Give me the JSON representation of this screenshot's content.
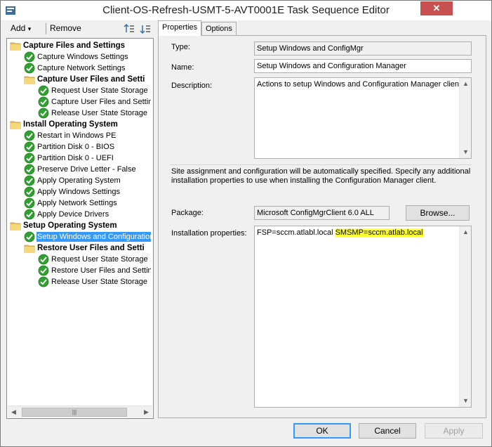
{
  "window": {
    "title": "Client-OS-Refresh-USMT-5-AVT0001E Task Sequence Editor",
    "close_glyph": "✕"
  },
  "toolbar": {
    "add_label": "Add",
    "add_arrow": "▾",
    "remove_label": "Remove"
  },
  "tree": {
    "items": [
      {
        "label": "Capture Files and Settings",
        "type": "group",
        "level": 0
      },
      {
        "label": "Capture Windows Settings",
        "type": "step",
        "level": 1
      },
      {
        "label": "Capture Network Settings",
        "type": "step",
        "level": 1
      },
      {
        "label": "Capture User Files and Setti",
        "type": "group",
        "level": 1
      },
      {
        "label": "Request User State Storage",
        "type": "step",
        "level": 2
      },
      {
        "label": "Capture User Files and Setting",
        "type": "step",
        "level": 2
      },
      {
        "label": "Release User State Storage",
        "type": "step",
        "level": 2
      },
      {
        "label": "Install Operating System",
        "type": "group",
        "level": 0
      },
      {
        "label": "Restart in Windows PE",
        "type": "step",
        "level": 1
      },
      {
        "label": "Partition Disk 0 - BIOS",
        "type": "step",
        "level": 1
      },
      {
        "label": "Partition Disk 0 - UEFI",
        "type": "step",
        "level": 1
      },
      {
        "label": "Preserve Drive Letter - False",
        "type": "step",
        "level": 1
      },
      {
        "label": "Apply Operating System",
        "type": "step",
        "level": 1
      },
      {
        "label": "Apply Windows Settings",
        "type": "step",
        "level": 1
      },
      {
        "label": "Apply Network Settings",
        "type": "step",
        "level": 1
      },
      {
        "label": "Apply Device Drivers",
        "type": "step",
        "level": 1
      },
      {
        "label": "Setup Operating System",
        "type": "group",
        "level": 0
      },
      {
        "label": "Setup Windows and Configuration",
        "type": "step",
        "level": 1,
        "selected": true
      },
      {
        "label": "Restore User Files and Setti",
        "type": "group",
        "level": 1
      },
      {
        "label": "Request User State Storage",
        "type": "step",
        "level": 2
      },
      {
        "label": "Restore User Files and Setting",
        "type": "step",
        "level": 2
      },
      {
        "label": "Release User State Storage",
        "type": "step",
        "level": 2
      }
    ],
    "scroll_thumb_glyph": "|||"
  },
  "tabs": [
    {
      "label": "Properties",
      "active": true
    },
    {
      "label": "Options",
      "active": false
    }
  ],
  "properties": {
    "type_label": "Type:",
    "type_value": "Setup Windows and ConfigMgr",
    "name_label": "Name:",
    "name_value": "Setup Windows and Configuration Manager",
    "description_label": "Description:",
    "description_value": "Actions to setup Windows and Configuration Manager client",
    "info_line1": "Site assignment and configuration will be automatically specified. Specify any additional",
    "info_line2": "installation properties to use when installing the Configuration Manager client.",
    "package_label": "Package:",
    "package_value": "Microsoft ConfigMgrClient 6.0 ALL",
    "browse_label": "Browse...",
    "install_props_label": "Installation properties:",
    "install_props_part1": "FSP=sccm.atlabl.local ",
    "install_props_part2": "SMSMP=sccm.atlab.local"
  },
  "footer": {
    "ok_label": "OK",
    "cancel_label": "Cancel",
    "apply_label": "Apply"
  },
  "colors": {
    "selection": "#3399ff",
    "highlight": "#ffff33",
    "close": "#c75050"
  }
}
